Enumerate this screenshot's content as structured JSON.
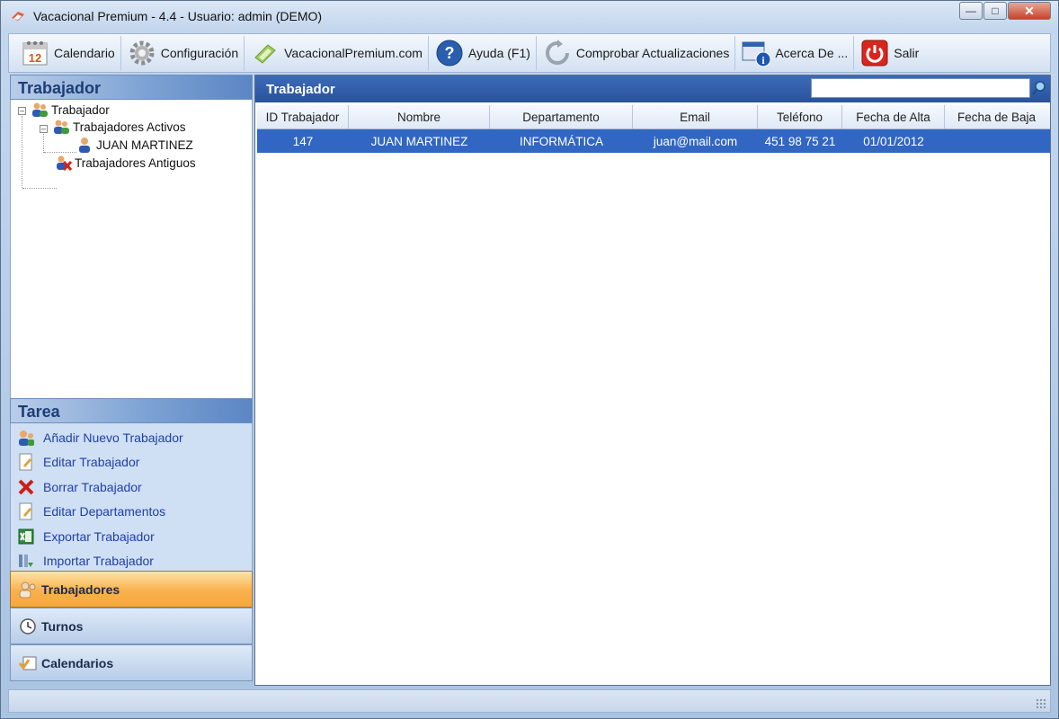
{
  "window": {
    "title": "Vacacional Premium - 4.4 - Usuario: admin (DEMO)"
  },
  "toolbar": {
    "items": [
      {
        "label": "Calendario",
        "icon": "calendar-icon"
      },
      {
        "label": "Configuración",
        "icon": "gear-icon"
      },
      {
        "label": "VacacionalPremium.com",
        "icon": "web-icon"
      },
      {
        "label": "Ayuda (F1)",
        "icon": "help-icon"
      },
      {
        "label": "Comprobar Actualizaciones",
        "icon": "refresh-icon"
      },
      {
        "label": "Acerca De ...",
        "icon": "info-icon"
      },
      {
        "label": "Salir",
        "icon": "power-icon"
      }
    ]
  },
  "left": {
    "header": "Trabajador",
    "calendar_number": "12",
    "tree": {
      "root": "Trabajador",
      "active": "Trabajadores Activos",
      "worker": "JUAN MARTINEZ",
      "former": "Trabajadores Antiguos"
    },
    "task_header": "Tarea",
    "tasks": [
      "Añadir Nuevo Trabajador",
      "Editar Trabajador",
      "Borrar Trabajador",
      "Editar Departamentos",
      "Exportar Trabajador",
      "Importar Trabajador"
    ],
    "nav": [
      "Trabajadores",
      "Turnos",
      "Calendarios"
    ]
  },
  "main": {
    "header": "Trabajador",
    "search": {
      "value": ""
    },
    "columns": [
      "ID Trabajador",
      "Nombre",
      "Departamento",
      "Email",
      "Teléfono",
      "Fecha de Alta",
      "Fecha de Baja"
    ],
    "rows": [
      [
        "147",
        "JUAN MARTINEZ",
        "INFORMÁTICA",
        "juan@mail.com",
        "451 98 75 21",
        "01/01/2012",
        ""
      ]
    ]
  },
  "colors": {
    "accent": "#3166c3",
    "selected_nav": "#f9b14d",
    "link": "#1f3ea8"
  }
}
